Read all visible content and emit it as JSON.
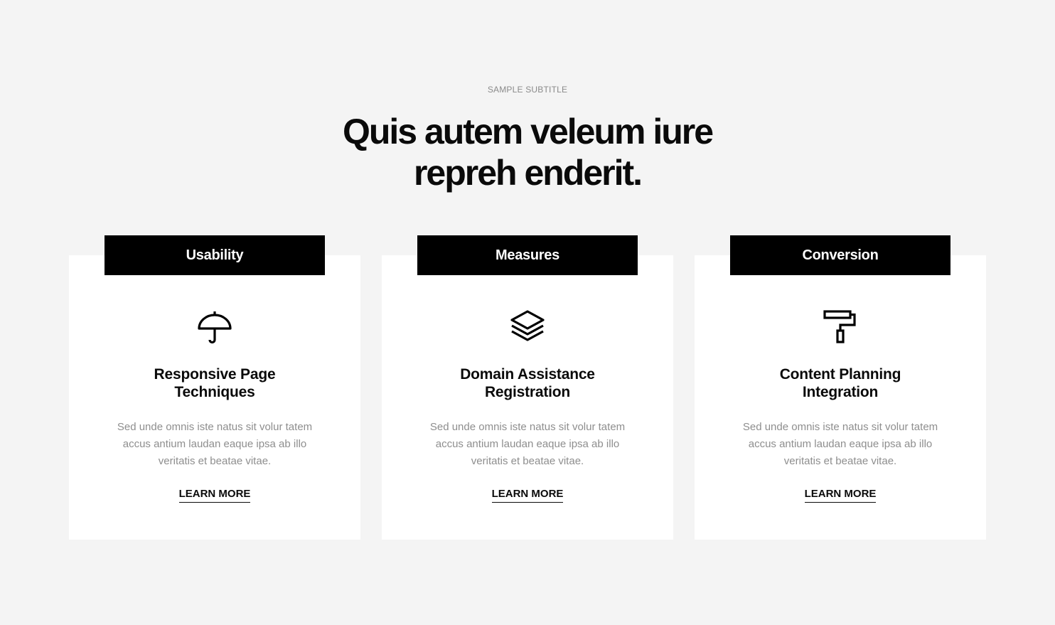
{
  "header": {
    "subtitle": "SAMPLE SUBTITLE",
    "title_line_1": "Quis autem veleum iure",
    "title_line_2": "repreh enderit."
  },
  "cards": [
    {
      "tab": "Usability",
      "icon": "umbrella-icon",
      "title_line_1": "Responsive Page",
      "title_line_2": "Techniques",
      "text": "Sed unde omnis iste natus sit volur tatem accus antium laudan eaque ipsa ab illo veritatis et beatae vitae.",
      "link": "LEARN MORE"
    },
    {
      "tab": "Measures",
      "icon": "layers-icon",
      "title_line_1": "Domain Assistance",
      "title_line_2": "Registration",
      "text": "Sed unde omnis iste natus sit volur tatem accus antium laudan eaque ipsa ab illo veritatis et beatae vitae.",
      "link": "LEARN MORE"
    },
    {
      "tab": "Conversion",
      "icon": "paint-roller-icon",
      "title_line_1": "Content Planning",
      "title_line_2": "Integration",
      "text": "Sed unde omnis iste natus sit volur tatem accus antium laudan eaque ipsa ab illo veritatis et beatae vitae.",
      "link": "LEARN MORE"
    }
  ],
  "colors": {
    "background": "#f4f4f4",
    "card": "#ffffff",
    "tab": "#000000",
    "muted_text": "#8e8e8e"
  }
}
